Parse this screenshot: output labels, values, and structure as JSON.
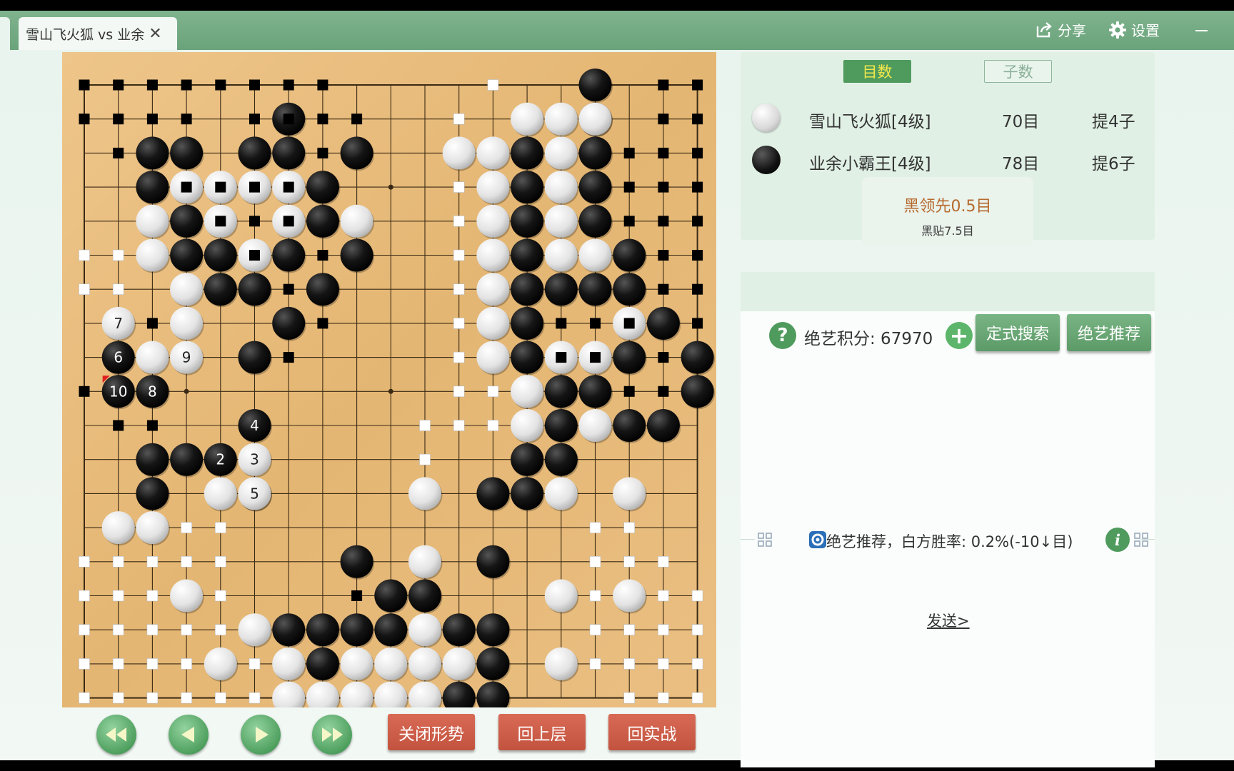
{
  "tab": {
    "title": "雪山飞火狐 vs 业余",
    "close": "✕"
  },
  "toolbar": {
    "share_label": "分享",
    "settings_label": "设置"
  },
  "score_panel": {
    "tabs": [
      "目数",
      "子数"
    ],
    "players": [
      {
        "name": "雪山飞火狐[4级]",
        "score": "70目",
        "captures": "提4子",
        "color": "white"
      },
      {
        "name": "业余小霸王[4级]",
        "score": "78目",
        "captures": "提6子",
        "color": "black"
      }
    ],
    "lead": "黑领先0.5目",
    "komi": "黑贴7.5目"
  },
  "ai_panel": {
    "points_label": "绝艺积分: 67970",
    "plus": "+",
    "help": "?",
    "buttons": {
      "joseki": "定式搜索",
      "recommend": "绝艺推荐"
    },
    "status": "绝艺推荐，白方胜率: 0.2%(-10↓目)",
    "info": "i",
    "send": "发送>"
  },
  "controls": {
    "close_analysis": "关闭形势",
    "back_level": "回上层",
    "back_game": "回实战"
  },
  "colors": {
    "board": "#e6b978",
    "title_bar": "#74ab84",
    "red_button": "#c95a45",
    "green_button": "#5c9a68",
    "lead_text": "#b66a2e"
  },
  "board": {
    "size": 19,
    "black_stones": [
      [
        15,
        0
      ],
      [
        6,
        1
      ],
      [
        15,
        1
      ],
      [
        2,
        2
      ],
      [
        3,
        2
      ],
      [
        5,
        2
      ],
      [
        6,
        2
      ],
      [
        8,
        2
      ],
      [
        13,
        2
      ],
      [
        15,
        2
      ],
      [
        2,
        3
      ],
      [
        7,
        3
      ],
      [
        13,
        3
      ],
      [
        15,
        3
      ],
      [
        3,
        4
      ],
      [
        7,
        4
      ],
      [
        13,
        4
      ],
      [
        15,
        4
      ],
      [
        3,
        5
      ],
      [
        4,
        5
      ],
      [
        6,
        5
      ],
      [
        8,
        5
      ],
      [
        13,
        5
      ],
      [
        16,
        5
      ],
      [
        4,
        6
      ],
      [
        5,
        6
      ],
      [
        7,
        6
      ],
      [
        13,
        6
      ],
      [
        14,
        6
      ],
      [
        15,
        6
      ],
      [
        16,
        6
      ],
      [
        6,
        7
      ],
      [
        13,
        7
      ],
      [
        17,
        7
      ],
      [
        5,
        8
      ],
      [
        13,
        8
      ],
      [
        16,
        8
      ],
      [
        18,
        8
      ],
      [
        14,
        9
      ],
      [
        15,
        9
      ],
      [
        18,
        9
      ],
      [
        14,
        10
      ],
      [
        16,
        10
      ],
      [
        17,
        10
      ],
      [
        2,
        11
      ],
      [
        3,
        11
      ],
      [
        13,
        11
      ],
      [
        14,
        11
      ],
      [
        2,
        12
      ],
      [
        12,
        12
      ],
      [
        13,
        12
      ],
      [
        8,
        14
      ],
      [
        12,
        14
      ],
      [
        9,
        15
      ],
      [
        10,
        15
      ],
      [
        6,
        16
      ],
      [
        7,
        16
      ],
      [
        8,
        16
      ],
      [
        9,
        16
      ],
      [
        11,
        16
      ],
      [
        12,
        16
      ],
      [
        7,
        17
      ],
      [
        12,
        17
      ],
      [
        11,
        18
      ],
      [
        12,
        18
      ]
    ],
    "white_stones": [
      [
        13,
        1
      ],
      [
        14,
        1
      ],
      [
        15,
        1
      ],
      [
        11,
        2
      ],
      [
        12,
        2
      ],
      [
        14,
        2
      ],
      [
        3,
        3
      ],
      [
        4,
        3
      ],
      [
        5,
        3
      ],
      [
        6,
        3
      ],
      [
        12,
        3
      ],
      [
        14,
        3
      ],
      [
        2,
        4
      ],
      [
        4,
        4
      ],
      [
        6,
        4
      ],
      [
        8,
        4
      ],
      [
        12,
        4
      ],
      [
        14,
        4
      ],
      [
        2,
        5
      ],
      [
        5,
        5
      ],
      [
        12,
        5
      ],
      [
        14,
        5
      ],
      [
        15,
        5
      ],
      [
        3,
        6
      ],
      [
        12,
        6
      ],
      [
        3,
        7
      ],
      [
        12,
        7
      ],
      [
        16,
        7
      ],
      [
        2,
        8
      ],
      [
        12,
        8
      ],
      [
        14,
        8
      ],
      [
        15,
        8
      ],
      [
        13,
        9
      ],
      [
        13,
        10
      ],
      [
        15,
        10
      ],
      [
        4,
        12
      ],
      [
        10,
        12
      ],
      [
        14,
        12
      ],
      [
        16,
        12
      ],
      [
        1,
        13
      ],
      [
        2,
        13
      ],
      [
        10,
        14
      ],
      [
        3,
        15
      ],
      [
        14,
        15
      ],
      [
        16,
        15
      ],
      [
        5,
        16
      ],
      [
        10,
        16
      ],
      [
        4,
        17
      ],
      [
        6,
        17
      ],
      [
        8,
        17
      ],
      [
        9,
        17
      ],
      [
        10,
        17
      ],
      [
        11,
        17
      ],
      [
        14,
        17
      ],
      [
        6,
        18
      ],
      [
        7,
        18
      ],
      [
        8,
        18
      ],
      [
        9,
        18
      ],
      [
        10,
        18
      ]
    ],
    "numbered": [
      {
        "x": 5,
        "y": 12,
        "n": "1",
        "color": "white"
      },
      {
        "x": 4,
        "y": 11,
        "n": "2",
        "color": "black"
      },
      {
        "x": 5,
        "y": 11,
        "n": "3",
        "color": "white"
      },
      {
        "x": 5,
        "y": 10,
        "n": "4",
        "color": "black"
      },
      {
        "x": 5,
        "y": 12,
        "n": "5",
        "color": "white"
      },
      {
        "x": 1,
        "y": 8,
        "n": "6",
        "color": "black"
      },
      {
        "x": 1,
        "y": 7,
        "n": "7",
        "color": "white"
      },
      {
        "x": 2,
        "y": 9,
        "n": "8",
        "color": "black"
      },
      {
        "x": 3,
        "y": 8,
        "n": "9",
        "color": "white"
      },
      {
        "x": 1,
        "y": 9,
        "n": "10",
        "color": "black"
      }
    ],
    "black_territory": [
      [
        0,
        0
      ],
      [
        1,
        0
      ],
      [
        2,
        0
      ],
      [
        3,
        0
      ],
      [
        4,
        0
      ],
      [
        5,
        0
      ],
      [
        6,
        0
      ],
      [
        7,
        0
      ],
      [
        17,
        0
      ],
      [
        18,
        0
      ],
      [
        0,
        1
      ],
      [
        1,
        1
      ],
      [
        2,
        1
      ],
      [
        3,
        1
      ],
      [
        5,
        1
      ],
      [
        6,
        1
      ],
      [
        7,
        1
      ],
      [
        8,
        1
      ],
      [
        17,
        1
      ],
      [
        18,
        1
      ],
      [
        1,
        2
      ],
      [
        7,
        2
      ],
      [
        16,
        2
      ],
      [
        17,
        2
      ],
      [
        18,
        2
      ],
      [
        3,
        3
      ],
      [
        4,
        3
      ],
      [
        5,
        3
      ],
      [
        6,
        3
      ],
      [
        16,
        3
      ],
      [
        17,
        3
      ],
      [
        18,
        3
      ],
      [
        4,
        4
      ],
      [
        5,
        4
      ],
      [
        6,
        4
      ],
      [
        16,
        4
      ],
      [
        17,
        4
      ],
      [
        18,
        4
      ],
      [
        5,
        5
      ],
      [
        7,
        5
      ],
      [
        17,
        5
      ],
      [
        18,
        5
      ],
      [
        6,
        6
      ],
      [
        17,
        6
      ],
      [
        18,
        6
      ],
      [
        2,
        7
      ],
      [
        7,
        7
      ],
      [
        14,
        7
      ],
      [
        15,
        7
      ],
      [
        16,
        7
      ],
      [
        18,
        7
      ],
      [
        6,
        8
      ],
      [
        14,
        8
      ],
      [
        15,
        8
      ],
      [
        17,
        8
      ],
      [
        0,
        9
      ],
      [
        16,
        9
      ],
      [
        17,
        9
      ],
      [
        1,
        10
      ],
      [
        2,
        10
      ],
      [
        8,
        15
      ]
    ],
    "white_territory": [
      [
        12,
        0
      ],
      [
        11,
        1
      ],
      [
        11,
        3
      ],
      [
        11,
        4
      ],
      [
        11,
        5
      ],
      [
        0,
        5
      ],
      [
        1,
        5
      ],
      [
        0,
        6
      ],
      [
        1,
        6
      ],
      [
        11,
        6
      ],
      [
        11,
        7
      ],
      [
        11,
        8
      ],
      [
        11,
        9
      ],
      [
        12,
        9
      ],
      [
        10,
        10
      ],
      [
        11,
        10
      ],
      [
        12,
        10
      ],
      [
        10,
        11
      ],
      [
        3,
        13
      ],
      [
        4,
        13
      ],
      [
        15,
        13
      ],
      [
        16,
        13
      ],
      [
        0,
        14
      ],
      [
        1,
        14
      ],
      [
        2,
        14
      ],
      [
        3,
        14
      ],
      [
        4,
        14
      ],
      [
        15,
        14
      ],
      [
        16,
        14
      ],
      [
        17,
        14
      ],
      [
        0,
        15
      ],
      [
        1,
        15
      ],
      [
        2,
        15
      ],
      [
        4,
        15
      ],
      [
        15,
        15
      ],
      [
        17,
        15
      ],
      [
        18,
        15
      ],
      [
        0,
        16
      ],
      [
        1,
        16
      ],
      [
        2,
        16
      ],
      [
        3,
        16
      ],
      [
        4,
        16
      ],
      [
        15,
        16
      ],
      [
        16,
        16
      ],
      [
        17,
        16
      ],
      [
        18,
        16
      ],
      [
        0,
        17
      ],
      [
        1,
        17
      ],
      [
        2,
        17
      ],
      [
        3,
        17
      ],
      [
        5,
        17
      ],
      [
        15,
        17
      ],
      [
        16,
        17
      ],
      [
        17,
        17
      ],
      [
        18,
        17
      ],
      [
        0,
        18
      ],
      [
        1,
        18
      ],
      [
        2,
        18
      ],
      [
        3,
        18
      ],
      [
        4,
        18
      ],
      [
        5,
        18
      ],
      [
        16,
        18
      ],
      [
        17,
        18
      ],
      [
        18,
        18
      ]
    ],
    "last_move": [
      1,
      9
    ]
  }
}
